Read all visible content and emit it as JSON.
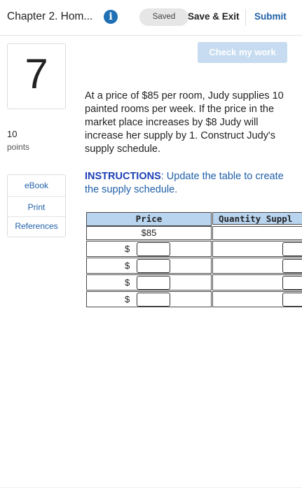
{
  "header": {
    "title": "Chapter 2. Hom...",
    "info_icon": "i",
    "saved_label": "Saved",
    "save_exit_label": "Save & Exit",
    "submit_label": "Submit"
  },
  "check_button": "Check my work",
  "question": {
    "number": "7",
    "points": "10",
    "points_label": "points",
    "text": "At a price of $85 per room, Judy supplies 10 painted rooms per week.  If the price in the market place increases by $8 Judy will increase her supply by 1. Construct Judy's supply schedule.",
    "instructions_bold": "INSTRUCTIONS",
    "instructions_rest": ":  Update the table to create the supply schedule."
  },
  "resources": [
    "eBook",
    "Print",
    "References"
  ],
  "table": {
    "headers": [
      "Price",
      "Quantity Suppl"
    ],
    "first_price": "$85",
    "currency": "$",
    "input_rows": 4
  },
  "colors": {
    "accent": "#1f5fa8",
    "instructions_bold": "#1d3fb8",
    "header_fill": "#b8d4ef",
    "check_button_disabled": "#c7dcf0",
    "info_icon": "#1f6fb5"
  }
}
